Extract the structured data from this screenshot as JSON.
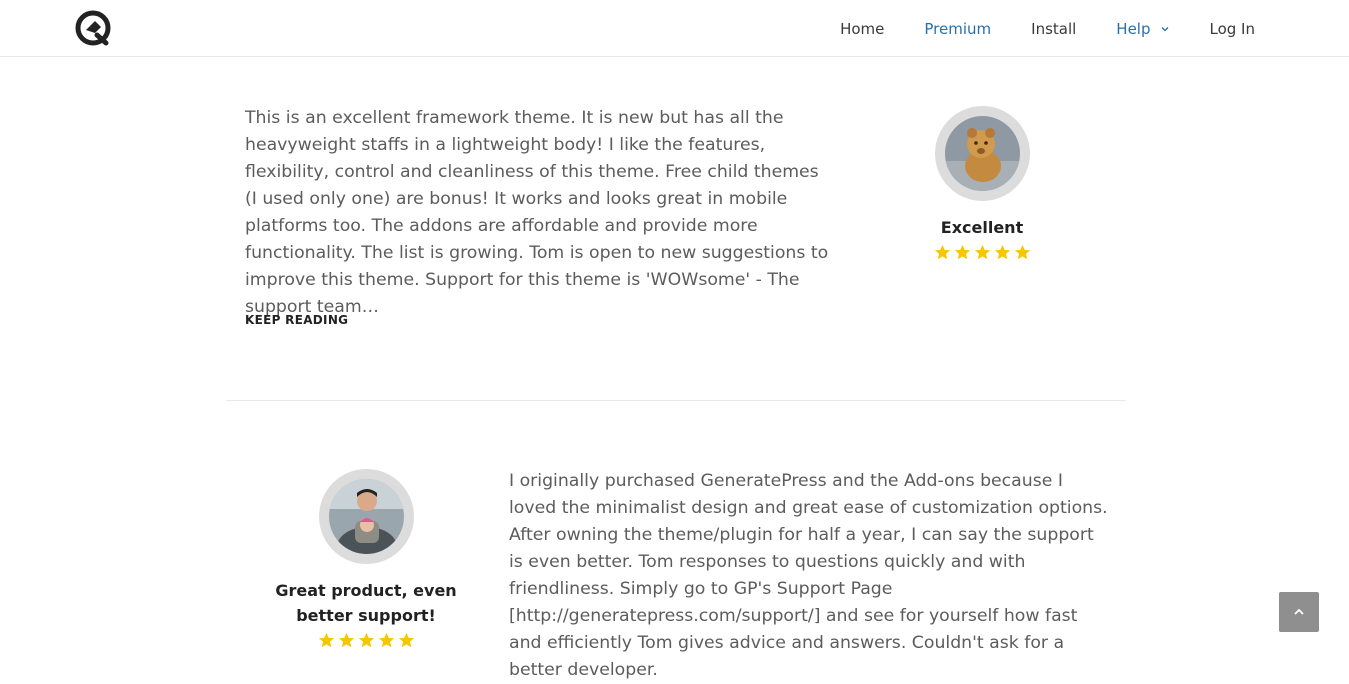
{
  "header": {
    "logo_icon": "generatepress-logo-icon",
    "nav": [
      {
        "label": "Home",
        "accent": false
      },
      {
        "label": "Premium",
        "accent": true
      },
      {
        "label": "Install",
        "accent": false
      },
      {
        "label": "Help",
        "accent": true,
        "has_dropdown": true
      },
      {
        "label": "Log In",
        "accent": false
      }
    ]
  },
  "reviews": [
    {
      "text": "This is an excellent framework theme. It is new but has all the heavyweight staffs in a lightweight body! I like the features, flexibility, control and cleanliness of this theme. Free child themes (I used only one) are bonus! It works and looks great in mobile platforms too. The addons are affordable and provide more functionality. The list is growing. Tom is open to new suggestions to improve this theme. Support for this theme is 'WOWsome' - The support team…",
      "keep_reading": "KEEP READING",
      "title": "Excellent",
      "rating": 5,
      "avatar": "lion-cub-avatar"
    },
    {
      "text": "I originally purchased GeneratePress and the Add-ons because I loved the minimalist design and great ease of customization options. After owning the theme/plugin for half a year, I can say the support is even better. Tom responses to questions quickly and with friendliness. Simply go to GP's Support Page [http://generatepress.com/support/] and see for yourself how fast and efficiently Tom gives advice and answers. Couldn't ask for a better developer.",
      "title": "Great product, even better support!",
      "rating": 5,
      "avatar": "man-with-baby-avatar"
    }
  ],
  "back_to_top_icon": "chevron-up-icon",
  "colors": {
    "accent": "#2b6fa8",
    "star": "#f7c600",
    "text": "#5c5c5c"
  }
}
